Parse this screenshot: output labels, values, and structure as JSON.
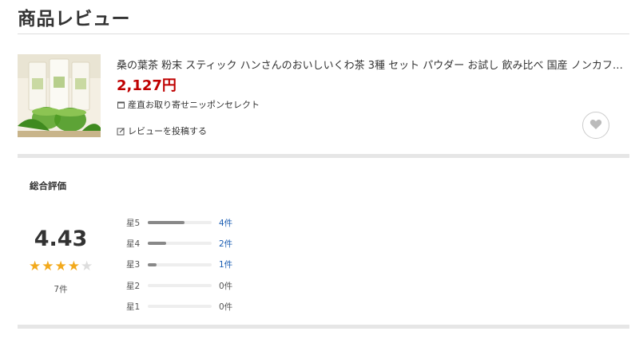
{
  "header": {
    "title": "商品レビュー"
  },
  "product": {
    "name": "桑の葉茶 粉末 スティック ハンさんのおいしいくわ茶 3種 セット パウダー お試し 飲み比べ 国産 ノンカフェイン",
    "price": "2,127円",
    "shop": "産直お取り寄せニッポンセレクト",
    "write_review": "レビューを投稿する"
  },
  "summary": {
    "heading": "総合評価",
    "average": "4.43",
    "rating": 4.43,
    "total": "7件",
    "distribution": [
      {
        "label": "星5",
        "count": "4件",
        "fraction": 0.571
      },
      {
        "label": "星4",
        "count": "2件",
        "fraction": 0.286
      },
      {
        "label": "星3",
        "count": "1件",
        "fraction": 0.143
      },
      {
        "label": "星2",
        "count": "0件",
        "fraction": 0
      },
      {
        "label": "星1",
        "count": "0件",
        "fraction": 0
      }
    ]
  },
  "colors": {
    "price": "#bf0000",
    "star": "#f2a91c",
    "link": "#1d5fb3"
  },
  "icons": {
    "shop": "shop-icon",
    "write": "pencil-square-icon",
    "favorite": "heart-icon"
  }
}
